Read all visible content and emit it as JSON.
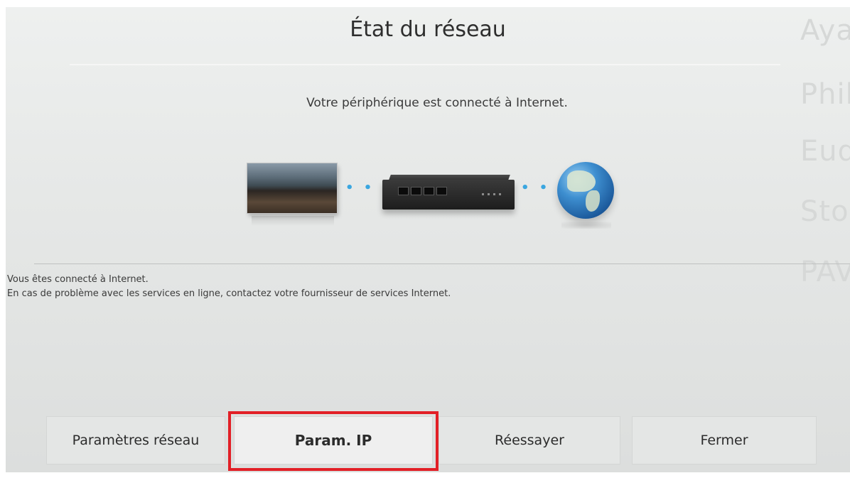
{
  "dialog": {
    "title": "État du réseau",
    "status_message": "Votre périphérique est connecté à Internet.",
    "info_lines": [
      "Vous êtes connecté à Internet.",
      "En cas de problème avec les services en ligne, contactez votre fournisseur de services Internet."
    ]
  },
  "diagram": {
    "nodes": [
      "tv-icon",
      "router-icon",
      "globe-icon"
    ],
    "connector_color": "#3aa6e0"
  },
  "buttons": [
    {
      "label": "Paramètres réseau",
      "focused": false
    },
    {
      "label": "Param. IP",
      "focused": true
    },
    {
      "label": "Réessayer",
      "focused": false
    },
    {
      "label": "Fermer",
      "focused": false
    }
  ],
  "background_list": [
    "Aya",
    "Phil",
    "Eud",
    "Sto",
    "PAV"
  ],
  "colors": {
    "focus_highlight": "#e21f26",
    "background": "#e6e8e7",
    "text": "#2e2e2e"
  }
}
